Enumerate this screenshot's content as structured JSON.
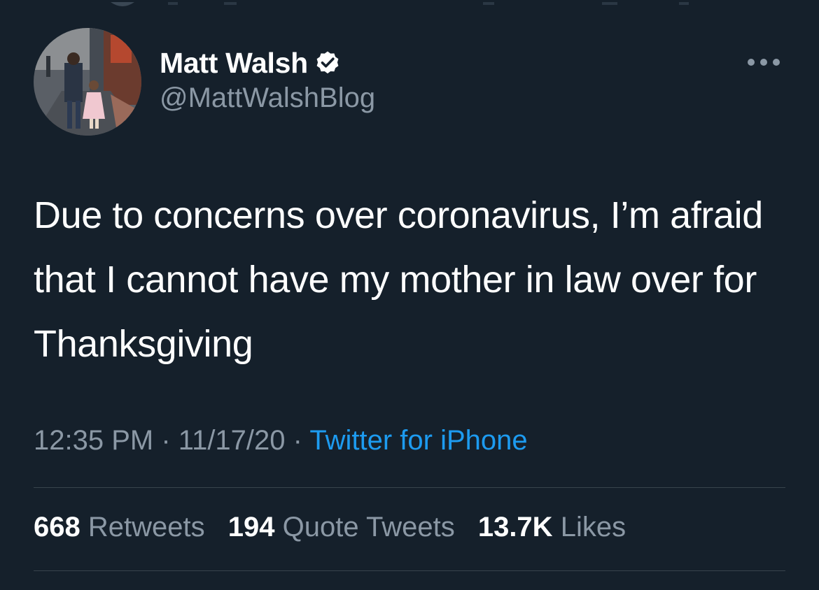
{
  "tweet": {
    "display_name": "Matt Walsh",
    "verified_icon": "verified-badge-icon",
    "handle": "@MattWalshBlog",
    "more_icon": "more-options-icon",
    "text": "Due to concerns over coronavirus, I’m afraid that I cannot have my mother in law over for Thanksgiving",
    "time": "12:35 PM",
    "separator": "·",
    "date": "11/17/20",
    "source": "Twitter for iPhone"
  },
  "stats": {
    "retweets_count": "668",
    "retweets_label": "Retweets",
    "quotes_count": "194",
    "quotes_label": "Quote Tweets",
    "likes_count": "13.7K",
    "likes_label": "Likes"
  },
  "colors": {
    "background": "#15202b",
    "primary_text": "#ffffff",
    "secondary_text": "#8b98a5",
    "link": "#1d9bf0",
    "divider": "#38444d"
  }
}
